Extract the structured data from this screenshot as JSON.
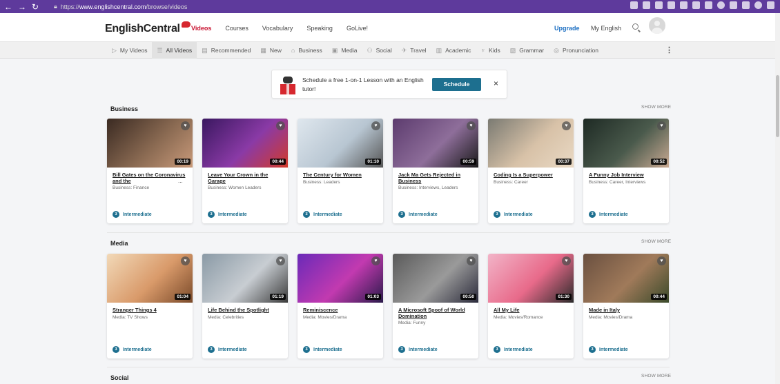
{
  "browser": {
    "url_prefix": "https://",
    "url_domain": "www.englishcentral.com",
    "url_path": "/browse/videos"
  },
  "header": {
    "logo": "EnglishCentral",
    "nav": [
      "Videos",
      "Courses",
      "Vocabulary",
      "Speaking",
      "GoLive!"
    ],
    "upgrade": "Upgrade",
    "my_english": "My English"
  },
  "categories": [
    {
      "icon": "▷",
      "label": "My Videos"
    },
    {
      "icon": "☰",
      "label": "All Videos"
    },
    {
      "icon": "▤",
      "label": "Recommended"
    },
    {
      "icon": "▦",
      "label": "New"
    },
    {
      "icon": "⌂",
      "label": "Business"
    },
    {
      "icon": "▣",
      "label": "Media"
    },
    {
      "icon": "⚇",
      "label": "Social"
    },
    {
      "icon": "✈",
      "label": "Travel"
    },
    {
      "icon": "▥",
      "label": "Academic"
    },
    {
      "icon": "♆",
      "label": "Kids"
    },
    {
      "icon": "▧",
      "label": "Grammar"
    },
    {
      "icon": "◎",
      "label": "Pronunciation"
    }
  ],
  "promo": {
    "text": "Schedule a free 1-on-1 Lesson with an English tutor!",
    "button": "Schedule",
    "close": "×"
  },
  "sections": {
    "business": {
      "title": "Business",
      "show_more": "SHOW MORE",
      "cards": [
        {
          "title": "Bill Gates on the Coronavirus and the",
          "subtitle": "Business: Finance",
          "duration": "00:19",
          "level": "Intermediate",
          "level_num": "3",
          "colors": [
            "#3a2a22",
            "#8a6a52",
            "#c99a7a"
          ]
        },
        {
          "title": "Leave Your Crown in the Garage",
          "subtitle": "Business: Women Leaders",
          "duration": "00:44",
          "level": "Intermediate",
          "level_num": "3",
          "colors": [
            "#3a1860",
            "#8a3aa6",
            "#d23a2a"
          ]
        },
        {
          "title": "The Century for Women",
          "subtitle": "Business: Leaders",
          "duration": "01:10",
          "level": "Intermediate",
          "level_num": "3",
          "colors": [
            "#dfe7ee",
            "#b8c6d2",
            "#555"
          ]
        },
        {
          "title": "Jack Ma Gets Rejected in Business",
          "subtitle": "Business: Interviews, Leaders",
          "duration": "00:59",
          "level": "Intermediate",
          "level_num": "3",
          "colors": [
            "#5c3b6e",
            "#8e6e9a",
            "#1a1a1a"
          ]
        },
        {
          "title": "Coding Is a Superpower",
          "subtitle": "Business: Career",
          "duration": "00:37",
          "level": "Intermediate",
          "level_num": "3",
          "colors": [
            "#7a7a72",
            "#d8c2a8",
            "#e9d9c4"
          ]
        },
        {
          "title": "A Funny Job Interview",
          "subtitle": "Business: Career, Interviews",
          "duration": "00:52",
          "level": "Intermediate",
          "level_num": "3",
          "colors": [
            "#1e2a24",
            "#4a5a4c",
            "#c9a992"
          ]
        }
      ]
    },
    "media": {
      "title": "Media",
      "show_more": "SHOW MORE",
      "cards": [
        {
          "title": "Stranger Things 4",
          "subtitle": "Media: TV Shows",
          "duration": "01:04",
          "level": "Intermediate",
          "level_num": "3",
          "colors": [
            "#f2d9b8",
            "#d99a6a",
            "#7a4a2a"
          ]
        },
        {
          "title": "Life Behind the Spotlight",
          "subtitle": "Media: Celebrities",
          "duration": "01:19",
          "level": "Intermediate",
          "level_num": "3",
          "colors": [
            "#8a9aa6",
            "#c8cdd2",
            "#3a3a3a"
          ]
        },
        {
          "title": "Reminiscence",
          "subtitle": "Media: Movies/Drama",
          "duration": "01:03",
          "level": "Intermediate",
          "level_num": "3",
          "colors": [
            "#6a2ab8",
            "#c23ab0",
            "#2a1a4a"
          ]
        },
        {
          "title": "A Microsoft Spoof of World Domination",
          "subtitle": "Media: Funny",
          "duration": "00:50",
          "level": "Intermediate",
          "level_num": "3",
          "colors": [
            "#5a5a5a",
            "#9a9a9a",
            "#2a2a3a"
          ]
        },
        {
          "title": "All My Life",
          "subtitle": "Media: Movies/Romance",
          "duration": "01:30",
          "level": "Intermediate",
          "level_num": "3",
          "colors": [
            "#f2b4c8",
            "#e86a8a",
            "#2a2a2a"
          ]
        },
        {
          "title": "Made in Italy",
          "subtitle": "Media: Movies/Drama",
          "duration": "00:44",
          "level": "Intermediate",
          "level_num": "3",
          "colors": [
            "#6a5040",
            "#a07a5a",
            "#3a4a2a"
          ]
        }
      ]
    },
    "social": {
      "title": "Social",
      "show_more": "SHOW MORE"
    }
  }
}
